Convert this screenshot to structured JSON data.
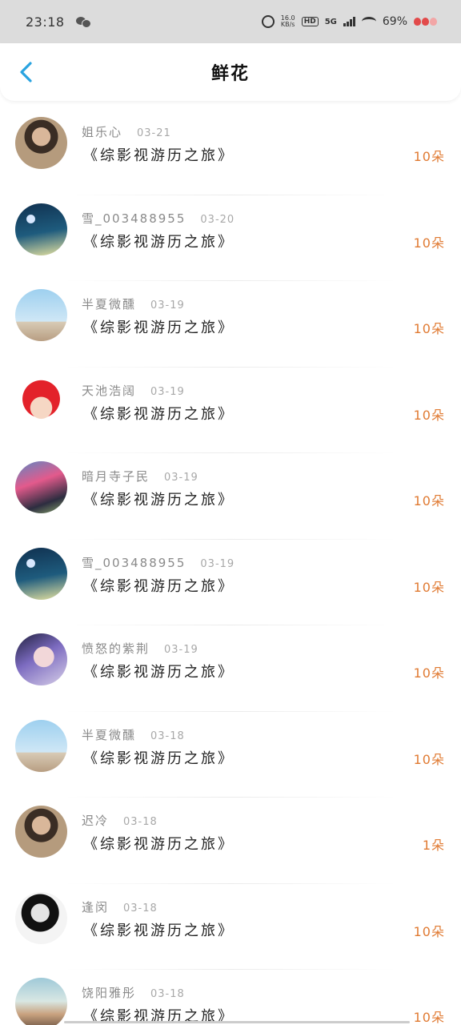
{
  "status_bar": {
    "time": "23:18",
    "speed_value": "16.0",
    "speed_unit": "KB/s",
    "hd": "HD",
    "network": "5G",
    "battery": "69%"
  },
  "nav": {
    "title": "鲜花"
  },
  "colors": {
    "accent": "#29a3e0",
    "count": "#e07a32"
  },
  "list": [
    {
      "user": "姐乐心",
      "date": "03-21",
      "title": "《综影视游历之旅》",
      "count": "10朵",
      "avatar": "person-photo"
    },
    {
      "user": "雪_003488955",
      "date": "03-20",
      "title": "《综影视游历之旅》",
      "count": "10朵",
      "avatar": "moon-poster"
    },
    {
      "user": "半夏微醺",
      "date": "03-19",
      "title": "《综影视游历之旅》",
      "count": "10朵",
      "avatar": "beach-cyclist"
    },
    {
      "user": "天池浩阔",
      "date": "03-19",
      "title": "《综影视游历之旅》",
      "count": "10朵",
      "avatar": "red-hair-cartoon"
    },
    {
      "user": "暗月寺子民",
      "date": "03-19",
      "title": "《综影视游历之旅》",
      "count": "10朵",
      "avatar": "cyclists"
    },
    {
      "user": "雪_003488955",
      "date": "03-19",
      "title": "《综影视游历之旅》",
      "count": "10朵",
      "avatar": "moon-poster"
    },
    {
      "user": "愤怒的紫荆",
      "date": "03-19",
      "title": "《综影视游历之旅》",
      "count": "10朵",
      "avatar": "purple-portrait"
    },
    {
      "user": "半夏微醺",
      "date": "03-18",
      "title": "《综影视游历之旅》",
      "count": "10朵",
      "avatar": "beach-cyclist"
    },
    {
      "user": "迟冷",
      "date": "03-18",
      "title": "《综影视游历之旅》",
      "count": "1朵",
      "avatar": "person-photo"
    },
    {
      "user": "逢闵",
      "date": "03-18",
      "title": "《综影视游历之旅》",
      "count": "10朵",
      "avatar": "bw-portrait"
    },
    {
      "user": "饶阳雅彤",
      "date": "03-18",
      "title": "《综影视游历之旅》",
      "count": "10朵",
      "avatar": "lying-person"
    }
  ]
}
